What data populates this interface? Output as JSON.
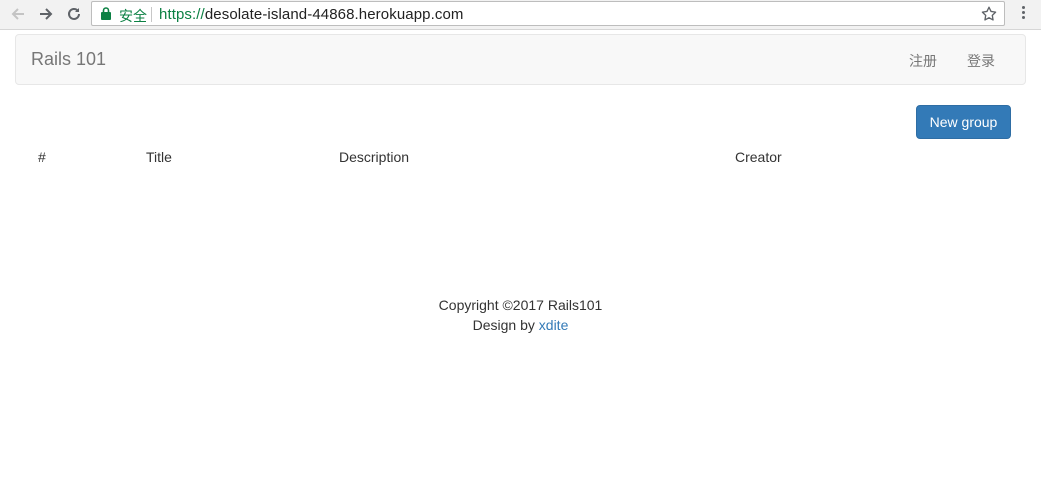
{
  "browser": {
    "secure_label": "安全",
    "url_scheme": "https://",
    "url_host": "desolate-island-44868.herokuapp.com",
    "icons": [
      "back-arrow-icon",
      "forward-arrow-icon",
      "reload-icon",
      "lock-icon",
      "star-icon",
      "more-menu-icon"
    ]
  },
  "navbar": {
    "brand": "Rails 101",
    "links": [
      "注册",
      "登录"
    ]
  },
  "main": {
    "new_group_label": "New group",
    "table_headers": [
      "#",
      "Title",
      "Description",
      "Creator"
    ]
  },
  "footer": {
    "copyright": "Copyright ©2017 Rails101",
    "design_by": "Design by",
    "author_link": "xdite"
  },
  "colors": {
    "primary": "#337ab7",
    "secure_green": "#0b8043",
    "navbar_bg": "#f8f8f8"
  }
}
